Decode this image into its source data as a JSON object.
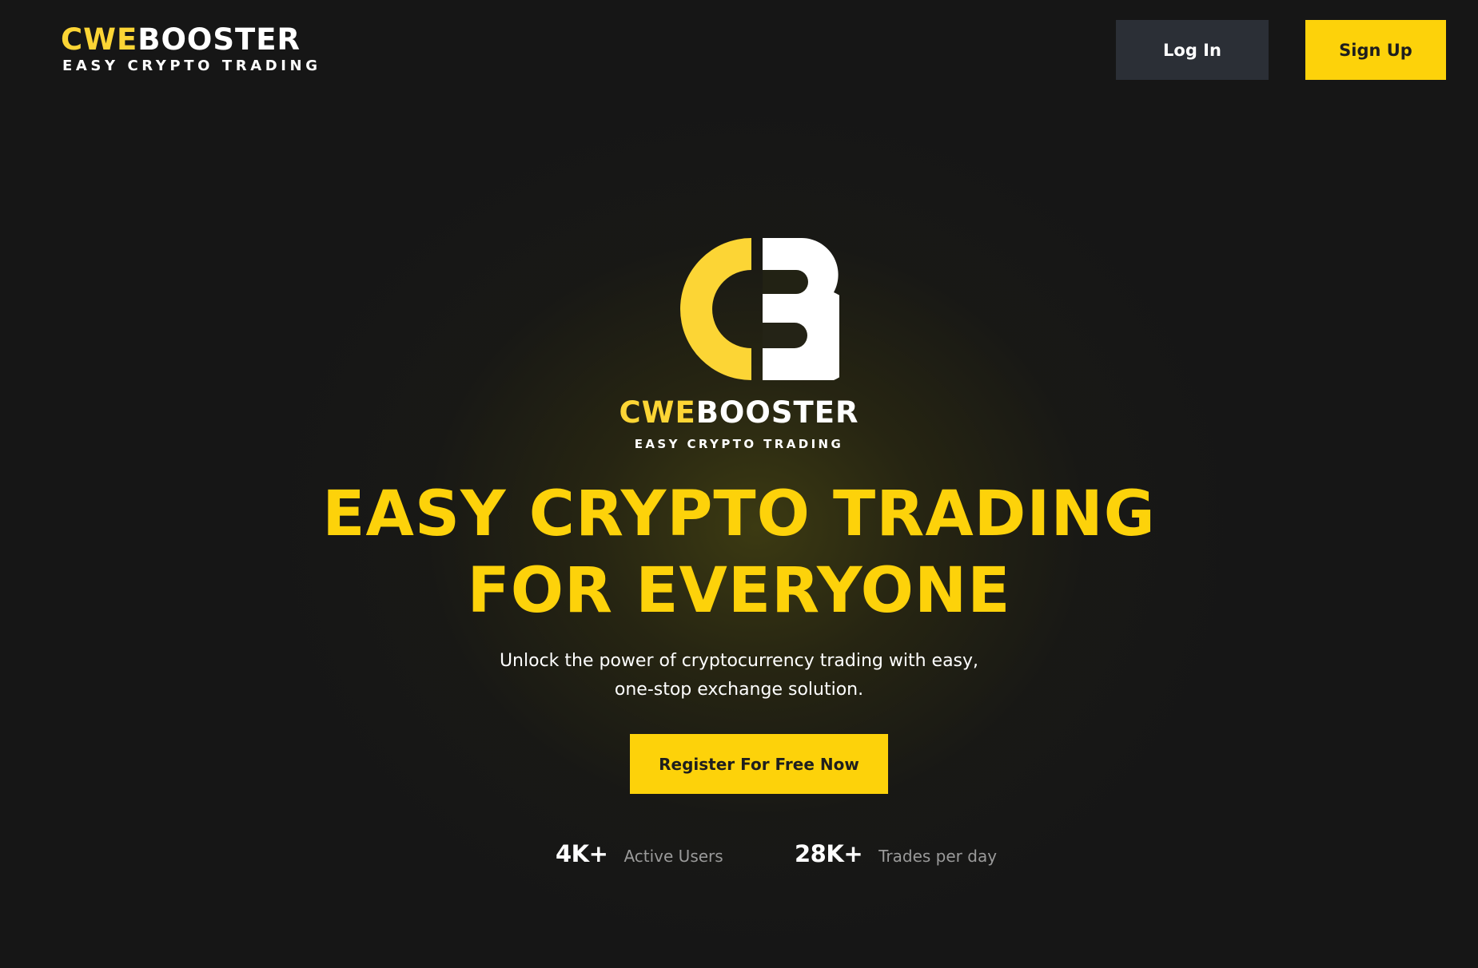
{
  "header": {
    "brand": {
      "part1": "CWE",
      "part2": "BOOSTER",
      "tagline": "EASY CRYPTO TRADING"
    },
    "login_label": "Log In",
    "signup_label": "Sign Up"
  },
  "hero": {
    "brand": {
      "part1": "CWE",
      "part2": "BOOSTER",
      "tagline": "EASY CRYPTO TRADING"
    },
    "headline": [
      "EASY CRYPTO TRADING",
      "FOR EVERYONE"
    ],
    "subtitle": [
      "Unlock the power of cryptocurrency trading with easy,",
      "one-stop exchange solution."
    ],
    "cta_label": "Register For Free Now",
    "stats": [
      {
        "value": "4K+",
        "label": "Active Users"
      },
      {
        "value": "28K+",
        "label": "Trades per day"
      }
    ]
  },
  "colors": {
    "background": "#161616",
    "accent": "#fdd20a",
    "login_button": "#2b2f36",
    "muted_text": "#9a9a9a"
  },
  "icons": {
    "hero_mark": "cb-logo-icon"
  }
}
